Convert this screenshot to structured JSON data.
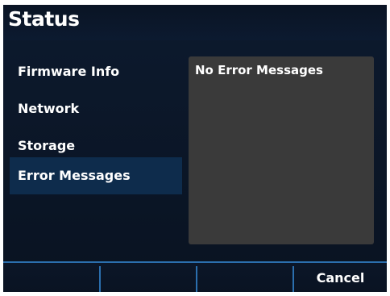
{
  "header": {
    "title": "Status"
  },
  "sidebar": {
    "items": [
      {
        "label": "Firmware Info",
        "selected": false
      },
      {
        "label": "Network",
        "selected": false
      },
      {
        "label": "Storage",
        "selected": false
      },
      {
        "label": "Error Messages",
        "selected": true
      }
    ]
  },
  "content": {
    "message": "No Error Messages"
  },
  "softkeys": {
    "key1": "",
    "key2": "",
    "key3": "",
    "key4": "Cancel"
  },
  "colors": {
    "background": "#0b1627",
    "selected_item": "#0e2c4c",
    "panel": "#3a3a3a",
    "accent_divider": "#2b6fae",
    "text": "#ffffff"
  }
}
